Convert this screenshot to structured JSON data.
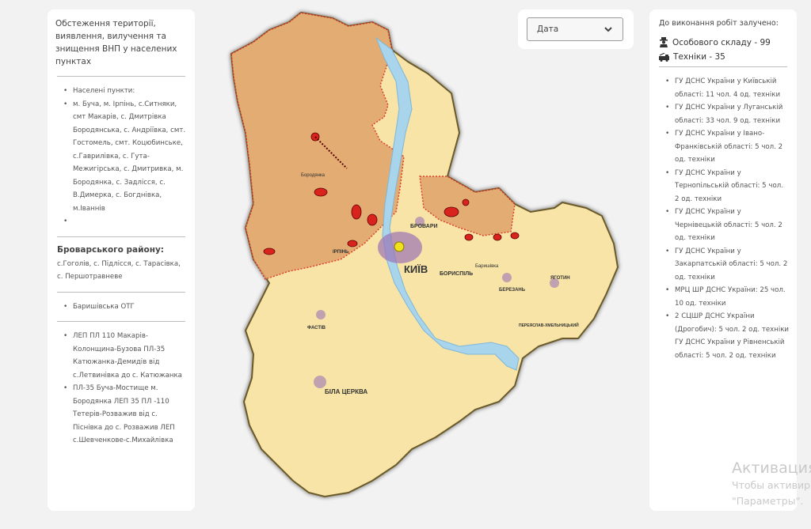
{
  "left_panel": {
    "title": "Обстеження території, виявлення, вилучення та знищення ВНП у населених пунктах",
    "settlements_header": "Населені пункти:",
    "settlements_text": "м. Буча, м. Ірпінь, с.Ситняки, смт Макарів, с. Дмитрівка Бородянська, с. Андріївка, смт. Гостомель, смт. Коцюбинське, с.Гаврилівка, с. Гута-Межигірська, с. Дмитривка, м. Бородянка, с. Задлісся, с. В.Димерка, с. Богднівка, м.Іваннів",
    "empty_bullet": "",
    "brovary_title": "Броварського району:",
    "brovary_text": "с.Гоголів, с. Підлісся, с. Тарасівка, с. Першотравневе",
    "baryshivka": "Баришівська ОТГ",
    "power_lines": [
      "ЛЕП ПЛ 110 Макарів-Колонщина-Бузова ПЛ-35 Катюжанка-Демидів від с.Летвинівка до с. Катюжанка",
      "ПЛ-35 Буча-Мостище м. Бородянка ЛЕП 35 ПЛ -110 Тетерів-Розважив від с. Піснівка до с. Розважив ЛЕП с.Шевченкове-с.Михайлівка"
    ]
  },
  "date_filter": {
    "label": "Дата",
    "icon": "chevron-down-icon"
  },
  "right_panel": {
    "title": "До виконання робіт залучено:",
    "personnel": {
      "icon": "firefighter-icon",
      "label": "Особового складу - 99"
    },
    "vehicles": {
      "icon": "fire-truck-icon",
      "label": "Техніки - 35"
    },
    "units": [
      "ГУ ДСНС України у Київській області: 11 чол. 4 од. техніки",
      "ГУ ДСНС України у Луганській області: 33 чол. 9 од. техніки",
      "ГУ ДСНС України у Івано-Франківській області: 5 чол. 2 од. техніки",
      "ГУ ДСНС України у Тернопільській області: 5 чол. 2 од. техніки",
      "ГУ ДСНС України у Чернівецькій області: 5 чол. 2 од. техніки",
      "ГУ ДСНС України у Закарпатській області: 5 чол. 2 од. техніки",
      "МРЦ ШР ДСНС України: 25 чол. 10 од. техніки",
      "2 СЦШР ДСНС України (Дрогобич): 5 чол. 2 од. техніки"
    ],
    "extra_unit": "ГУ ДСНС України у Рівненській області: 5 чол. 2 од. техніки"
  },
  "map": {
    "labels": {
      "kyiv": "КИЇВ",
      "brovary": "БРОВАРИ",
      "boryspil": "БОРИСПІЛЬ",
      "bila_tserkva": "БІЛА ЦЕРКВА",
      "fastiv": "ФАСТІВ",
      "berezan": "БЕРЕЗАНЬ",
      "yahotyn": "ЯГОТИН",
      "pereyaslav": "ПЕРЕЯСЛАВ-ХМЕЛЬНИЦЬКИЙ",
      "irpin": "ІРПІНЬ",
      "borodianka": "Бородянка",
      "baryshivka": "Баришівка"
    },
    "colors": {
      "occupied_zone": "#e0a36a",
      "region_fill": "#f7e4a6",
      "water": "#a8d4ec",
      "city": "#9b74b5",
      "danger_marker": "#d8241c",
      "kyiv_marker": "#f2e21c"
    }
  },
  "watermark": {
    "title": "Активация",
    "line1": "Чтобы активир",
    "line2": "\"Параметры\"."
  }
}
